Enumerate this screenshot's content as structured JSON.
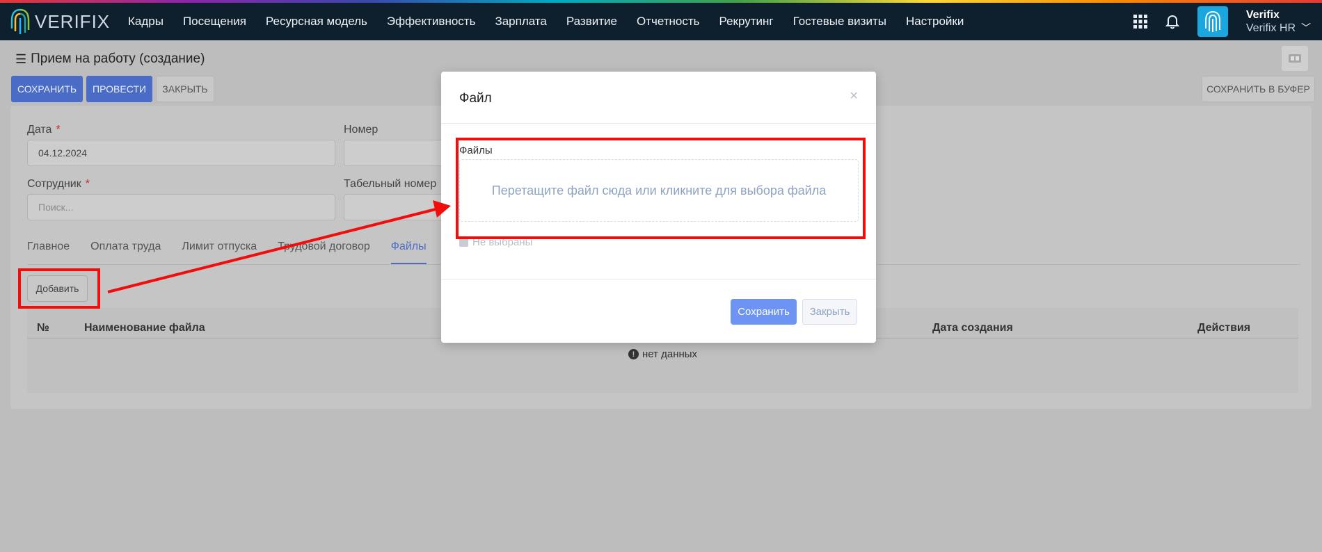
{
  "navbar": {
    "logo_text": "VERIFIX",
    "menu": [
      "Кадры",
      "Посещения",
      "Ресурсная модель",
      "Эффективность",
      "Зарплата",
      "Развитие",
      "Отчетность",
      "Рекрутинг",
      "Гостевые визиты",
      "Настройки"
    ],
    "user_name": "Verifix",
    "user_company": "Verifix HR"
  },
  "page": {
    "title": "Прием на работу (создание)",
    "buttons": {
      "save": "СОХРАНИТЬ",
      "post": "ПРОВЕСТИ",
      "close": "ЗАКРЫТЬ",
      "save_buffer": "СОХРАНИТЬ В БУФЕР"
    }
  },
  "form": {
    "date_label": "Дата",
    "date_value": "04.12.2024",
    "number_label": "Номер",
    "employee_label": "Сотрудник",
    "employee_placeholder": "Поиск...",
    "tabnum_label": "Табельный номер",
    "required_mark": "*"
  },
  "tabs": [
    "Главное",
    "Оплата труда",
    "Лимит отпуска",
    "Трудовой договор",
    "Файлы"
  ],
  "active_tab": "Файлы",
  "files_table": {
    "add_button": "Добавить",
    "columns": [
      "№",
      "Наименование файла",
      "Дата создания",
      "Действия"
    ],
    "empty_text": "нет данных"
  },
  "modal": {
    "title": "Файл",
    "close_glyph": "×",
    "files_label": "Файлы",
    "dropzone_text": "Перетащите файл сюда или кликните для выбора файла",
    "not_selected": "Не выбраны",
    "save": "Сохранить",
    "close": "Закрыть"
  },
  "colors": {
    "navbar": "#0e1f2e",
    "primary": "#4a6cc7",
    "modal_primary": "#6d93f5",
    "annotation": "#f20d0d"
  }
}
